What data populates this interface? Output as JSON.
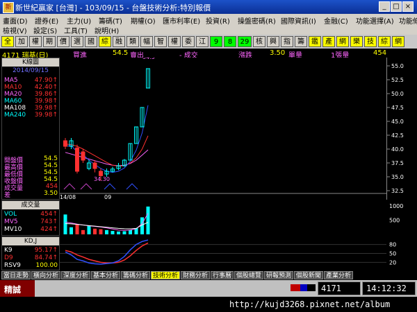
{
  "window": {
    "title": "新世紀贏家 [台灣] - 103/09/15 - 台盤技術分析:特別報價",
    "icon": "app-logo-icon"
  },
  "menu": {
    "row1": [
      "畫面(D)",
      "證券(E)",
      "主力(U)",
      "籌碼(T)",
      "期權(O)",
      "匯市利率(E)",
      "投資(R)",
      "操盤密碼(R)",
      "國際資訊(I)",
      "金融(C)",
      "功能選擇(A)",
      "功能條件(P)"
    ],
    "row2": [
      "檢視(V)",
      "設定(S)",
      "工具(T)",
      "說明(H)"
    ]
  },
  "toolbar": {
    "buttons": [
      "全",
      "加",
      "權",
      "期",
      "價",
      "選",
      "國",
      "綜",
      "融",
      "類",
      "幅",
      "智",
      "權",
      "委",
      "江",
      "9",
      "8",
      "29",
      "核",
      "興",
      "指",
      "籌",
      "鑑",
      "產",
      "網",
      "樂",
      "技",
      "綜",
      "網"
    ]
  },
  "quote": {
    "code_name": "4171 瑞基(日)",
    "buy_label": "買進",
    "buy_value": "54.5",
    "sell_label": "賣出",
    "change_label": "- 成交",
    "rise_label": "漲跌",
    "rise_value": "3.50",
    "volume_label": "單量",
    "volume_value": "1張量",
    "total_value": "454"
  },
  "kpanel": {
    "header": "K線圖",
    "date": "2014/09/15",
    "ma": [
      {
        "label": "MA5",
        "value": "47.90↑",
        "color": "#ff66ff"
      },
      {
        "label": "MA10",
        "value": "42.40↑",
        "color": "#ff3030"
      },
      {
        "label": "MA20",
        "value": "39.86↑",
        "color": "#ff66ff"
      },
      {
        "label": "MA60",
        "value": "39.98↑",
        "color": "#00ffff"
      },
      {
        "label": "MA108",
        "value": "39.98↑",
        "color": "#ffffff"
      },
      {
        "label": "MA240",
        "value": "39.98↑",
        "color": "#00ffff"
      }
    ],
    "prices": [
      {
        "label": "開盤價",
        "value": "54.5"
      },
      {
        "label": "最高價",
        "value": "54.5"
      },
      {
        "label": "最低價",
        "value": "54.5"
      },
      {
        "label": "收盤價",
        "value": "54.5"
      },
      {
        "label": "成交量",
        "value": "454"
      },
      {
        "label": "差",
        "value": "3.50"
      }
    ]
  },
  "chart_data": {
    "type": "candlestick",
    "y_ticks": [
      "55.0",
      "52.5",
      "50.0",
      "47.5",
      "45.0",
      "42.5",
      "40.0",
      "37.5",
      "35.0",
      "32.5"
    ],
    "ylim": [
      32.5,
      55.0
    ],
    "x_labels": [
      "14/08",
      "09"
    ],
    "high_label": "54.5",
    "low_label": "34.30",
    "candles": [
      {
        "open": 41.5,
        "close": 40.5,
        "high": 42.0,
        "low": 40.0,
        "up": false
      },
      {
        "open": 40.5,
        "close": 41.5,
        "high": 42.0,
        "low": 40.0,
        "up": true
      },
      {
        "open": 40.2,
        "close": 36.0,
        "high": 40.8,
        "low": 35.6,
        "up": false
      },
      {
        "open": 39.5,
        "close": 38.0,
        "high": 40.0,
        "low": 37.5,
        "up": false
      },
      {
        "open": 36.5,
        "close": 37.5,
        "high": 38.0,
        "low": 36.2,
        "up": true
      },
      {
        "open": 37.5,
        "close": 36.5,
        "high": 38.0,
        "low": 35.8,
        "up": false
      },
      {
        "open": 36.0,
        "close": 35.2,
        "high": 36.5,
        "low": 34.3,
        "up": false
      },
      {
        "open": 35.5,
        "close": 36.0,
        "high": 36.5,
        "low": 35.0,
        "up": true
      },
      {
        "open": 36.0,
        "close": 36.4,
        "high": 36.8,
        "low": 35.8,
        "up": true
      },
      {
        "open": 36.5,
        "close": 37.0,
        "high": 37.5,
        "low": 36.2,
        "up": true
      },
      {
        "open": 37.0,
        "close": 38.0,
        "high": 38.2,
        "low": 36.8,
        "up": true
      },
      {
        "open": 38.0,
        "close": 41.0,
        "high": 41.0,
        "low": 38.0,
        "up": true
      },
      {
        "open": 41.0,
        "close": 44.0,
        "high": 44.0,
        "low": 41.0,
        "up": true
      },
      {
        "open": 44.0,
        "close": 47.5,
        "high": 47.5,
        "low": 44.0,
        "up": true
      },
      {
        "open": 51.0,
        "close": 54.5,
        "high": 54.5,
        "low": 51.0,
        "up": true
      }
    ],
    "ma5": [
      40.5,
      40.6,
      39.5,
      39.0,
      38.0,
      37.2,
      36.5,
      36.0,
      35.8,
      36.0,
      36.6,
      37.8,
      39.8,
      42.9,
      47.9
    ],
    "ma10": [
      40.9,
      40.8,
      40.5,
      40.0,
      39.4,
      38.8,
      38.2,
      37.6,
      37.1,
      36.9,
      37.0,
      37.5,
      38.4,
      40.0,
      42.4
    ],
    "ma20": [
      39.4,
      39.1,
      38.8,
      38.5,
      38.2,
      37.9,
      37.6,
      37.3,
      37.1,
      37.0,
      37.1,
      37.4,
      38.0,
      38.9,
      39.86
    ]
  },
  "volume_panel": {
    "header": "成交量",
    "rows": [
      {
        "label": "VOL",
        "value": "454↑",
        "color": "#00ffff"
      },
      {
        "label": "MV5",
        "value": "743↑",
        "color": "#ff66ff"
      },
      {
        "label": "MV10",
        "value": "424↑",
        "color": "#ffffff"
      }
    ],
    "y_ticks": [
      "1000",
      "500"
    ],
    "bars": [
      700,
      250,
      350,
      150,
      300,
      200,
      180,
      150,
      120,
      100,
      110,
      160,
      220,
      600,
      980
    ],
    "mv5": [
      430,
      400,
      360,
      330,
      300,
      280,
      260,
      230,
      190,
      150,
      140,
      150,
      200,
      380,
      743
    ],
    "mv10": [
      380,
      370,
      350,
      330,
      310,
      290,
      270,
      250,
      230,
      210,
      200,
      195,
      210,
      330,
      424
    ]
  },
  "kd_panel": {
    "header": "KD,J",
    "rows": [
      {
        "label": "K9",
        "value": "95.17↑",
        "color": "#ffffff"
      },
      {
        "label": "D9",
        "value": "84.74↑",
        "color": "#ff3030"
      },
      {
        "label": "RSV9",
        "value": "100.00",
        "color": "#ffffff"
      }
    ],
    "y_ticks": [
      "80",
      "50",
      "20"
    ],
    "k": [
      55,
      45,
      30,
      25,
      18,
      15,
      14,
      16,
      18,
      25,
      40,
      62,
      80,
      90,
      95
    ],
    "d": [
      60,
      55,
      45,
      38,
      30,
      25,
      20,
      18,
      18,
      20,
      28,
      42,
      60,
      75,
      85
    ]
  },
  "tabs": [
    "當日走勢",
    "橫向分析",
    "深度分析",
    "基本分析",
    "籌碼分析",
    "技術分析",
    "財務分析",
    "行事曆",
    "個股總覽",
    "研報預測",
    "個股新聞",
    "產業分析"
  ],
  "active_tab": "技術分析",
  "status": {
    "label": "精誠",
    "code": "4171",
    "time": "14:12:32"
  },
  "bottom": {
    "url": "http://kujd3268.pixnet.net/album"
  }
}
